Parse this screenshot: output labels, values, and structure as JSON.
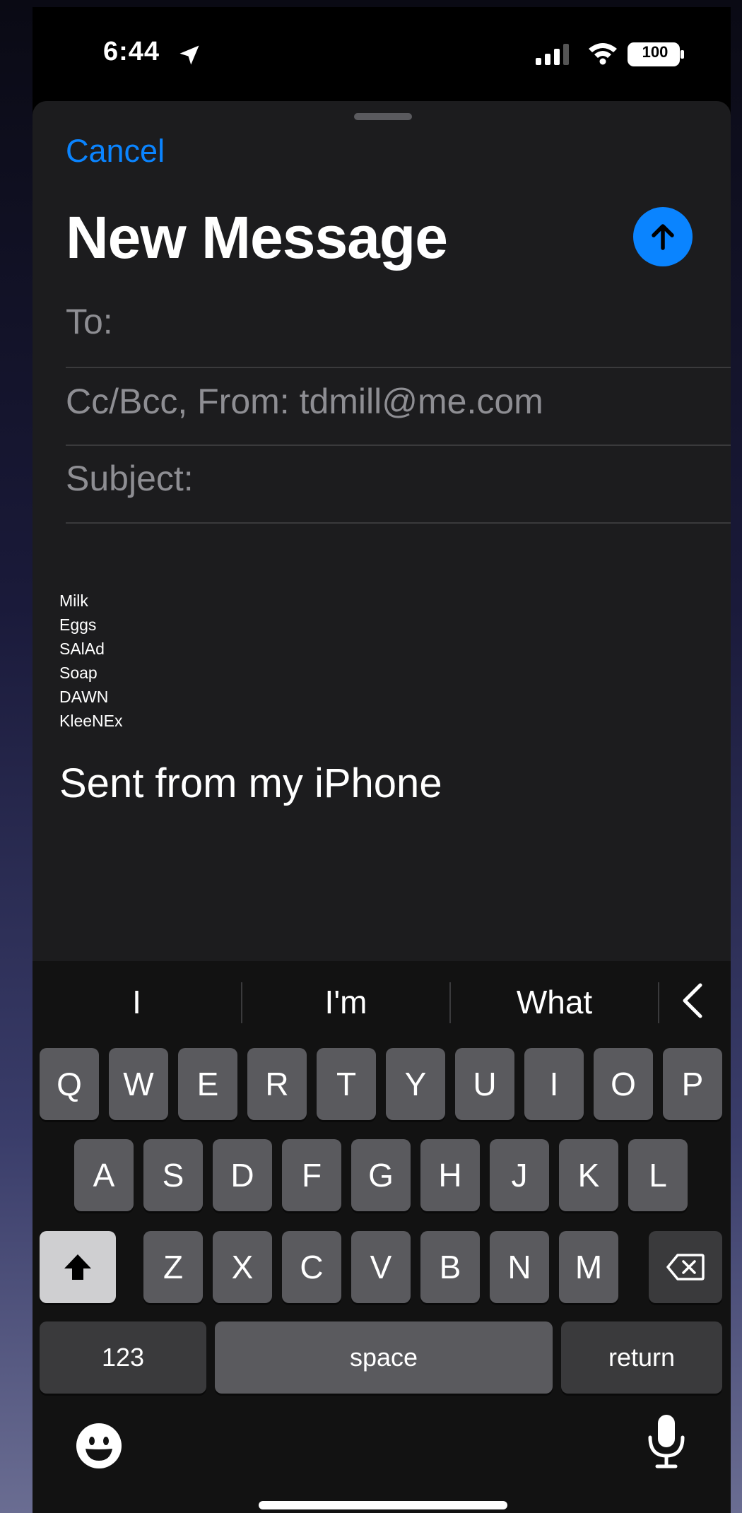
{
  "status_bar": {
    "time": "6:44",
    "battery": "100",
    "icons": [
      "location-arrow-icon",
      "signal-icon",
      "wifi-icon",
      "battery-icon"
    ]
  },
  "compose": {
    "cancel_label": "Cancel",
    "title": "New Message",
    "to_label": "To:",
    "cc_from_label": "Cc/Bcc, From: tdmill@me.com",
    "subject_label": "Subject:",
    "body_lines": [
      "Milk",
      "Eggs",
      "SAlAd",
      "Soap",
      "DAWN",
      "KleeNEx"
    ],
    "signature": "Sent from my iPhone",
    "accent_color": "#0a84ff"
  },
  "keyboard": {
    "predictions": [
      "I",
      "I'm",
      "What"
    ],
    "row1": [
      "Q",
      "W",
      "E",
      "R",
      "T",
      "Y",
      "U",
      "I",
      "O",
      "P"
    ],
    "row2": [
      "A",
      "S",
      "D",
      "F",
      "G",
      "H",
      "J",
      "K",
      "L"
    ],
    "row3": [
      "Z",
      "X",
      "C",
      "V",
      "B",
      "N",
      "M"
    ],
    "numbers_label": "123",
    "space_label": "space",
    "return_label": "return"
  }
}
